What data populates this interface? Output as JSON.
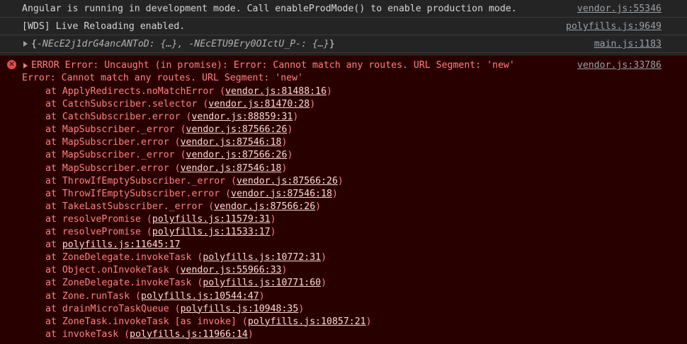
{
  "messages": [
    {
      "text": "Angular is running in development mode. Call enableProdMode() to enable production mode.",
      "source": "vendor.js:55346"
    },
    {
      "text": "[WDS] Live Reloading enabled.",
      "source": "polyfills.js:9649"
    }
  ],
  "object_log": {
    "open": "{",
    "text": "-NEcE2j1drG4ancANToD: {…}, -NEcETU9Ery0OIctU_P-: {…}",
    "close": "}",
    "source": "main.js:1183"
  },
  "error": {
    "icon": "error-circle-icon",
    "header": "ERROR Error: Uncaught (in promise): Error: Cannot match any routes. URL Segment: 'new'",
    "source": "vendor.js:33786",
    "message": "Error: Cannot match any routes. URL Segment: 'new'",
    "stack": [
      {
        "fn": "ApplyRedirects.noMatchError",
        "loc": "vendor.js:81488:16"
      },
      {
        "fn": "CatchSubscriber.selector",
        "loc": "vendor.js:81470:28"
      },
      {
        "fn": "CatchSubscriber.error",
        "loc": "vendor.js:88859:31"
      },
      {
        "fn": "MapSubscriber._error",
        "loc": "vendor.js:87566:26"
      },
      {
        "fn": "MapSubscriber.error",
        "loc": "vendor.js:87546:18"
      },
      {
        "fn": "MapSubscriber._error",
        "loc": "vendor.js:87566:26"
      },
      {
        "fn": "MapSubscriber.error",
        "loc": "vendor.js:87546:18"
      },
      {
        "fn": "ThrowIfEmptySubscriber._error",
        "loc": "vendor.js:87566:26"
      },
      {
        "fn": "ThrowIfEmptySubscriber.error",
        "loc": "vendor.js:87546:18"
      },
      {
        "fn": "TakeLastSubscriber._error",
        "loc": "vendor.js:87566:26"
      },
      {
        "fn": "resolvePromise",
        "loc": "polyfills.js:11579:31"
      },
      {
        "fn": "resolvePromise",
        "loc": "polyfills.js:11533:17"
      },
      {
        "fn": "",
        "loc": "polyfills.js:11645:17"
      },
      {
        "fn": "ZoneDelegate.invokeTask",
        "loc": "polyfills.js:10772:31"
      },
      {
        "fn": "Object.onInvokeTask",
        "loc": "vendor.js:55966:33"
      },
      {
        "fn": "ZoneDelegate.invokeTask",
        "loc": "polyfills.js:10771:60"
      },
      {
        "fn": "Zone.runTask",
        "loc": "polyfills.js:10544:47"
      },
      {
        "fn": "drainMicroTaskQueue",
        "loc": "polyfills.js:10948:35"
      },
      {
        "fn": "ZoneTask.invokeTask [as invoke]",
        "loc": "polyfills.js:10857:21"
      },
      {
        "fn": "invokeTask",
        "loc": "polyfills.js:11966:14"
      }
    ]
  }
}
